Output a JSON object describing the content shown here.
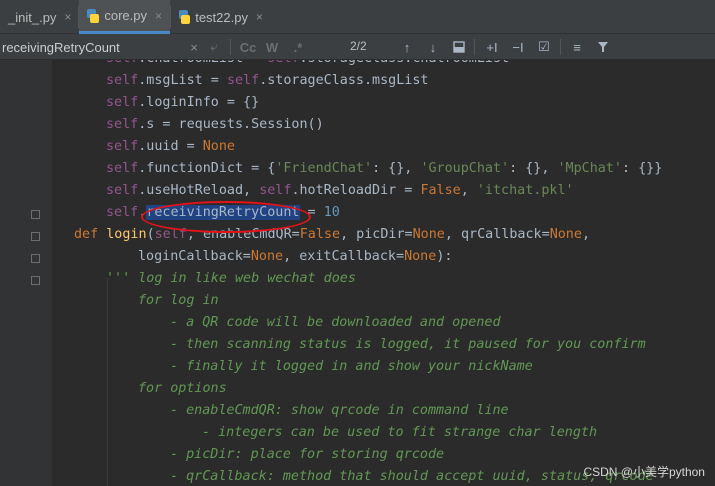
{
  "tabs": [
    {
      "label": "_init_.py",
      "close": "×"
    },
    {
      "label": "core.py",
      "close": "×"
    },
    {
      "label": "test22.py",
      "close": "×"
    }
  ],
  "search": {
    "value": "receivingRetryCount",
    "close": "×",
    "match_count": "2/2",
    "case_label": "Cc",
    "word_label": "W",
    "regex_label": ".*"
  },
  "code": [
    {
      "tokens": [
        [
          "self",
          "self"
        ],
        [
          ".chatroomList = ",
          ""
        ],
        [
          "self",
          "self"
        ],
        [
          ".storageClass.chatroomList",
          ""
        ]
      ]
    },
    {
      "tokens": [
        [
          "self",
          "self"
        ],
        [
          ".msgList = ",
          ""
        ],
        [
          "self",
          "self"
        ],
        [
          ".storageClass.msgList",
          ""
        ]
      ]
    },
    {
      "tokens": [
        [
          "self",
          "self"
        ],
        [
          ".loginInfo = {}",
          ""
        ]
      ]
    },
    {
      "tokens": [
        [
          "self",
          "self"
        ],
        [
          ".s = requests.Session()",
          ""
        ]
      ]
    },
    {
      "tokens": [
        [
          "self",
          "self"
        ],
        [
          ".uuid = ",
          ""
        ],
        [
          "None",
          "kw"
        ]
      ]
    },
    {
      "tokens": [
        [
          "self",
          "self"
        ],
        [
          ".functionDict = {",
          ""
        ],
        [
          "'FriendChat'",
          "str"
        ],
        [
          ": {}, ",
          ""
        ],
        [
          "'GroupChat'",
          "str"
        ],
        [
          ": {}, ",
          ""
        ],
        [
          "'MpChat'",
          "str"
        ],
        [
          ": {}}",
          ""
        ]
      ]
    },
    {
      "tokens": [
        [
          "self",
          "self"
        ],
        [
          ".useHotReload, ",
          ""
        ],
        [
          "self",
          "self"
        ],
        [
          ".hotReloadDir = ",
          ""
        ],
        [
          "False",
          "kw"
        ],
        [
          ", ",
          ""
        ],
        [
          "'itchat.pkl'",
          "str"
        ]
      ]
    },
    {
      "tokens": [
        [
          "self",
          "self"
        ],
        [
          ".",
          ""
        ],
        [
          "receivingRetryCount",
          "hl"
        ],
        [
          " = ",
          ""
        ],
        [
          "10",
          "num"
        ]
      ]
    },
    {
      "tokens": [
        [
          "def ",
          "kw"
        ],
        [
          "login",
          "fn"
        ],
        [
          "(",
          ""
        ],
        [
          "self",
          "self"
        ],
        [
          ", enableCmdQR=",
          ""
        ],
        [
          "False",
          "kw"
        ],
        [
          ", picDir=",
          ""
        ],
        [
          "None",
          "kw"
        ],
        [
          ", qrCallback=",
          ""
        ],
        [
          "None",
          "kw"
        ],
        [
          ",",
          ""
        ]
      ]
    },
    {
      "tokens": [
        [
          "loginCallback=",
          ""
        ],
        [
          "None",
          "kw"
        ],
        [
          ", exitCallback=",
          ""
        ],
        [
          "None",
          "kw"
        ],
        [
          "):",
          ""
        ]
      ]
    },
    {
      "tokens": [
        [
          "''' log in like web wechat does",
          "doc"
        ]
      ]
    },
    {
      "tokens": [
        [
          "for log in",
          "doc"
        ]
      ]
    },
    {
      "tokens": [
        [
          "- a QR code will be downloaded and opened",
          "doc"
        ]
      ]
    },
    {
      "tokens": [
        [
          "- then scanning status is logged, it paused for you confirm",
          "doc"
        ]
      ]
    },
    {
      "tokens": [
        [
          "- finally it logged in and show your nickName",
          "doc"
        ]
      ]
    },
    {
      "tokens": [
        [
          "for options",
          "doc"
        ]
      ]
    },
    {
      "tokens": [
        [
          "- enableCmdQR: show qrcode in command line",
          "doc"
        ]
      ]
    },
    {
      "tokens": [
        [
          "- integers can be used to fit strange char length",
          "doc"
        ]
      ]
    },
    {
      "tokens": [
        [
          "- picDir: place for storing qrcode",
          "doc"
        ]
      ]
    },
    {
      "tokens": [
        [
          "- qrCallback: method that should accept uuid, status, qrcode",
          "doc"
        ]
      ]
    }
  ],
  "watermark": "CSDN @小美学python"
}
